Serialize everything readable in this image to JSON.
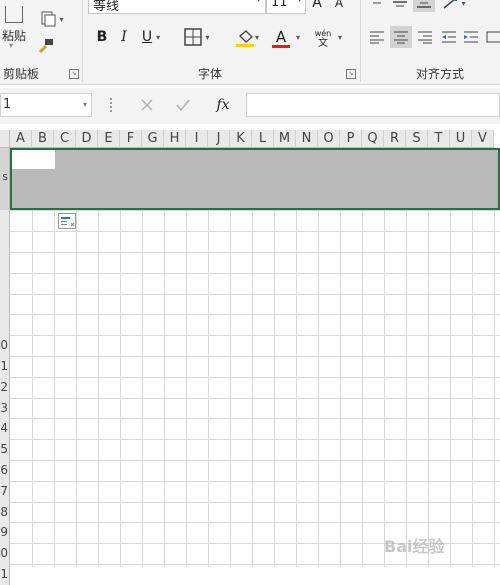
{
  "ribbon": {
    "clipboard": {
      "paste_label": "粘贴",
      "group_label": "剪贴板"
    },
    "font": {
      "font_name": "等线",
      "font_size": "11",
      "grow_label": "A",
      "shrink_label": "A",
      "bold": "B",
      "italic": "I",
      "underline": "U",
      "font_color_label": "A",
      "phonetic_top": "wén",
      "phonetic_bottom": "文",
      "group_label": "字体"
    },
    "alignment": {
      "group_label": "对齐方式"
    }
  },
  "formula_bar": {
    "name_box": "1",
    "fx_label": "fx",
    "formula": ""
  },
  "sheet": {
    "columns": [
      "A",
      "B",
      "C",
      "D",
      "E",
      "F",
      "G",
      "H",
      "I",
      "J",
      "K",
      "L",
      "M",
      "N",
      "O",
      "P",
      "Q",
      "R",
      "S",
      "T",
      "U",
      "V"
    ],
    "row_headers": [
      "0",
      "1",
      "2",
      "3",
      "4",
      "5",
      "6",
      "7",
      "8",
      "9",
      "0",
      "1"
    ],
    "selected_row_marker": "s"
  },
  "watermark": "Bai经验",
  "colors": {
    "accent": "#217346",
    "selection": "#b9b9b9",
    "font_color_bar": "#e0201b",
    "fill_color_bar": "#f5d000"
  }
}
